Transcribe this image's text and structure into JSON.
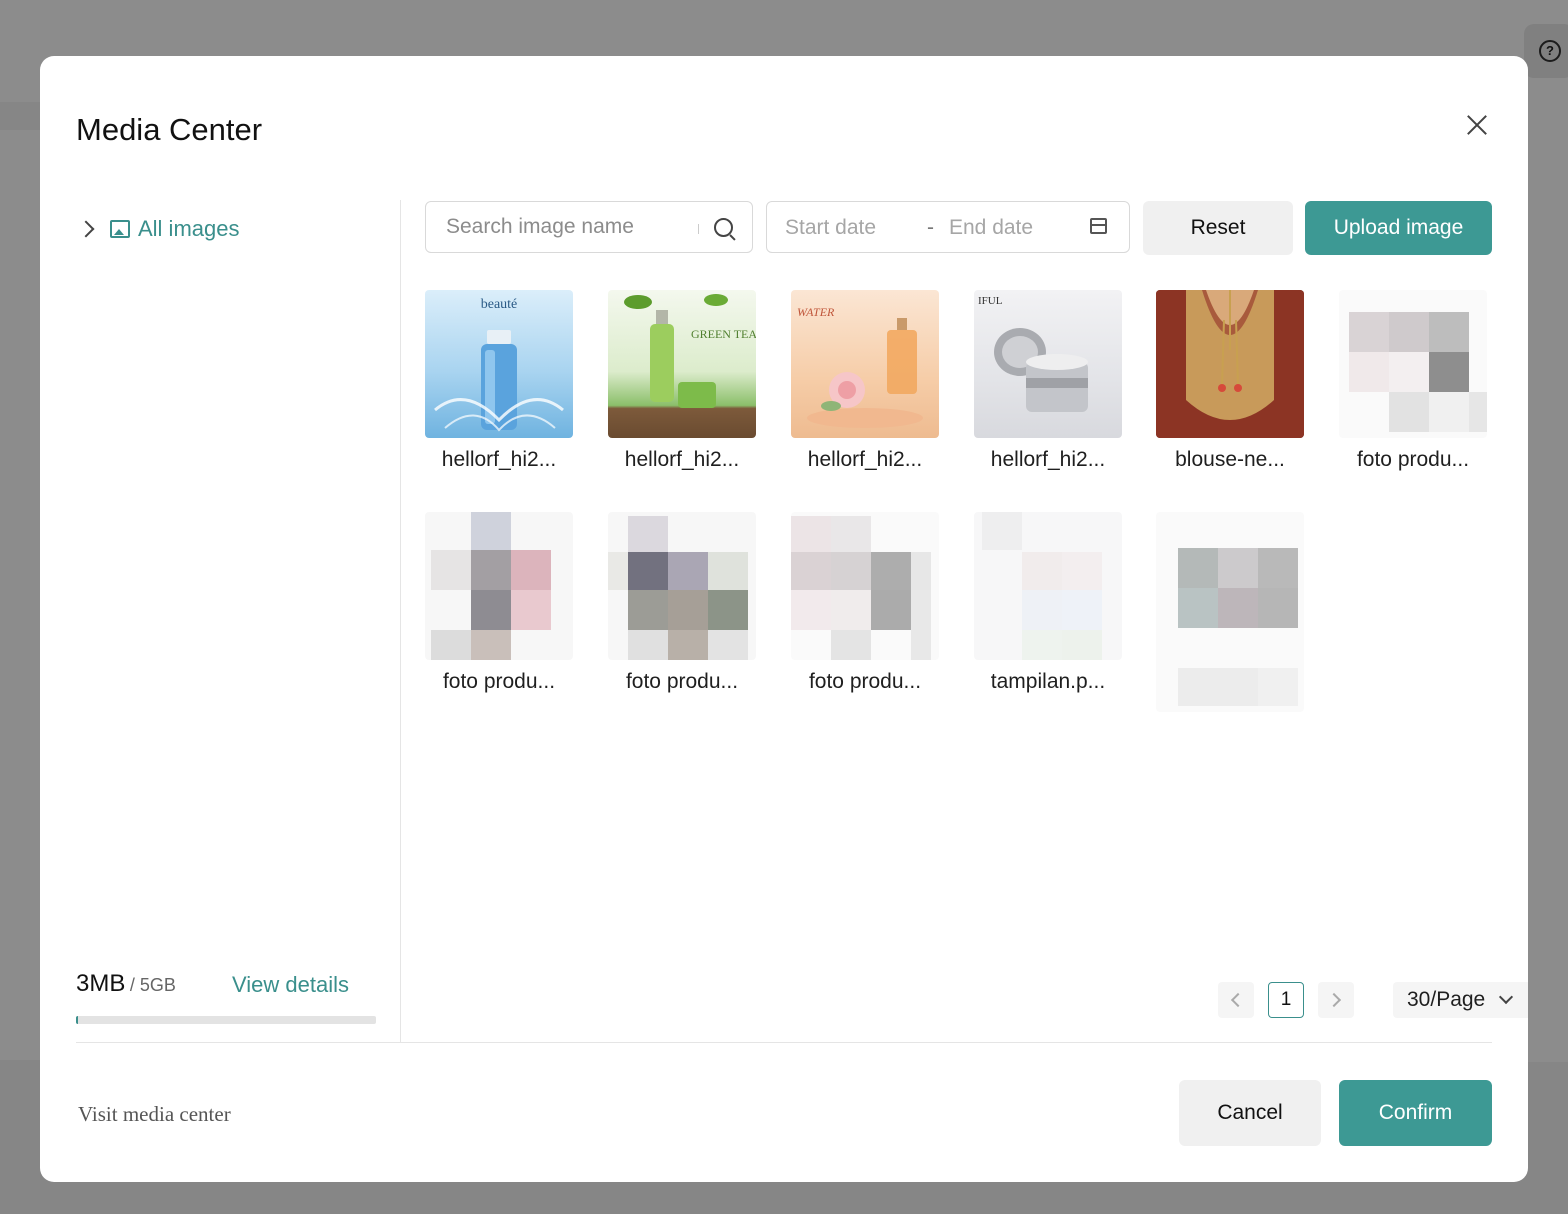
{
  "modal": {
    "title": "Media Center"
  },
  "sidebar": {
    "tree": [
      {
        "label": "All images",
        "icon": "image-icon",
        "expand_icon": "chevron-right-icon"
      }
    ],
    "storage": {
      "used": "3MB",
      "total": "/ 5GB",
      "used_fraction": 0.0006,
      "details_label": "View details"
    }
  },
  "toolbar": {
    "search_placeholder": "Search image name",
    "start_date_placeholder": "Start date",
    "date_separator": "-",
    "end_date_placeholder": "End date",
    "reset_label": "Reset",
    "upload_label": "Upload image"
  },
  "images": [
    {
      "name": "hellorf_hi2..."
    },
    {
      "name": "hellorf_hi2..."
    },
    {
      "name": "hellorf_hi2..."
    },
    {
      "name": "hellorf_hi2..."
    },
    {
      "name": "blouse-ne..."
    },
    {
      "name": "foto produ..."
    },
    {
      "name": "foto produ..."
    },
    {
      "name": "foto produ..."
    },
    {
      "name": "foto produ..."
    },
    {
      "name": "tampilan.p..."
    },
    {
      "name": ""
    }
  ],
  "pagination": {
    "current_page": "1",
    "page_size": "30/Page"
  },
  "footer": {
    "visit_label": "Visit media center",
    "cancel_label": "Cancel",
    "confirm_label": "Confirm"
  },
  "colors": {
    "accent": "#3d9994",
    "link": "#3a8f8c"
  }
}
